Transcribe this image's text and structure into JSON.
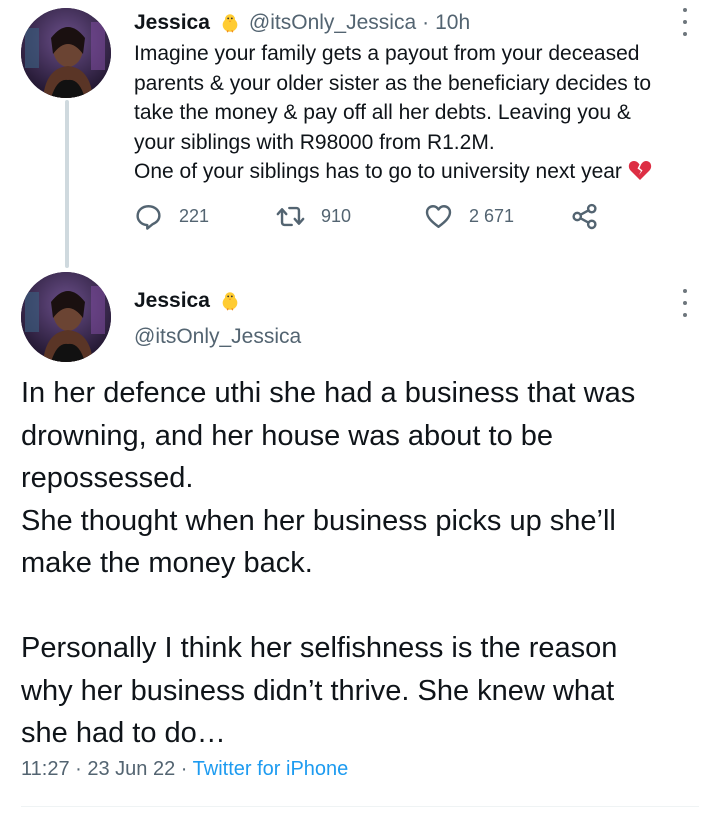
{
  "tweet1": {
    "name": "Jessica",
    "handle": "@itsOnly_Jessica",
    "separator": "·",
    "time": "10h",
    "lines": [
      "Imagine your family gets a payout from your deceased",
      "parents & your older sister as the beneficiary decides to",
      "take the money & pay off all her debts. Leaving you &",
      "your siblings with R98000 from R1.2M.",
      "One of your siblings has to go to university next year"
    ],
    "replies": "221",
    "retweets": "910",
    "likes": "2 671"
  },
  "tweet2": {
    "name": "Jessica",
    "handle": "@itsOnly_Jessica",
    "lines": [
      "In her defence uthi she had a business that was",
      "drowning, and her house was about to be",
      "repossessed.",
      "She thought when her business picks up she’ll",
      "make the money back.",
      "",
      "Personally I think her selfishness is the reason",
      "why her business didn’t thrive. She knew what",
      "she had to do…"
    ],
    "time": "11:27",
    "separator": "·",
    "date": "23 Jun 22",
    "source": "Twitter for iPhone"
  },
  "icons": {
    "name_emoji": "chick-emoji",
    "end_emoji": "broken-heart-emoji",
    "reply": "reply-icon",
    "retweet": "retweet-icon",
    "like": "heart-icon",
    "share": "share-icon",
    "more": "more-icon"
  },
  "colors": {
    "text": "#0f1419",
    "secondary": "#536471",
    "link": "#1d9bf0",
    "thread_line": "#cfd9de"
  }
}
